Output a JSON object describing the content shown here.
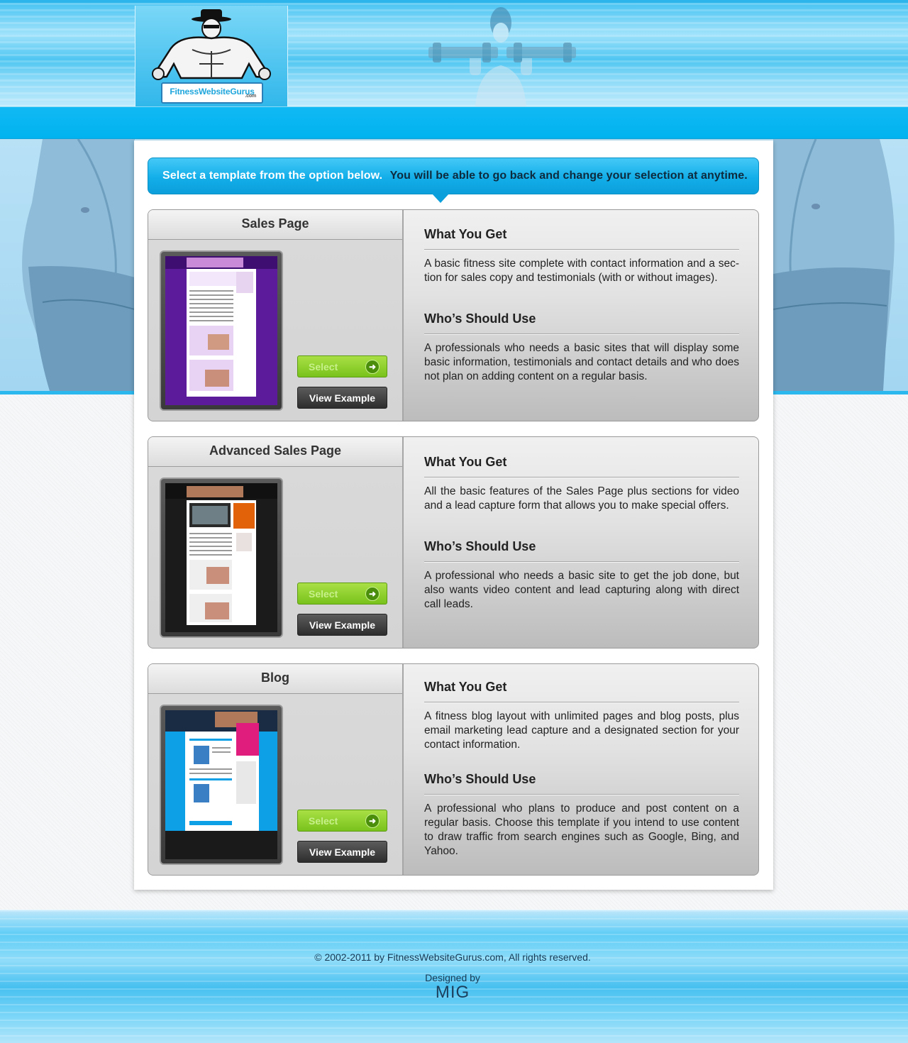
{
  "logo": {
    "name": "FitnessWebsiteGurus",
    "suffix": ".com"
  },
  "banner": {
    "text_white": "Select  a template from the option below.",
    "text_dark": "You will be able to go back and change your selection at anytime."
  },
  "templates": [
    {
      "title": "Sales Page",
      "select_label": "Select",
      "view_label": "View Example",
      "what_heading": "What You Get",
      "what_text": "A basic fitness site complete with contact information and a sec-tion for sales copy and testimonials (with or without images).",
      "who_heading": "Who’s Should Use",
      "who_text": "A professionals who needs a basic sites that will display some basic information, testimonials and contact details and who does not plan on adding content on a regular basis."
    },
    {
      "title": "Advanced Sales Page",
      "select_label": "Select",
      "view_label": "View Example",
      "what_heading": "What You Get",
      "what_text": "All the basic features of the Sales Page plus sections for video and a lead capture form that allows you to make special offers.",
      "who_heading": "Who’s Should Use",
      "who_text": "A professional who needs a basic site to get the job done, but also wants video content and lead capturing along with direct call leads."
    },
    {
      "title": "Blog",
      "select_label": "Select",
      "view_label": "View Example",
      "what_heading": "What You Get",
      "what_text": "A fitness blog layout with unlimited pages and blog posts, plus email marketing lead capture and a designated section for your contact information.",
      "who_heading": "Who’s Should Use",
      "who_text": "A professional who plans to produce and post content on a regular basis. Choose this template if you intend to use content to draw traffic from search engines such as Google, Bing, and Yahoo."
    }
  ],
  "footer": {
    "copyright": "© 2002-2011 by FitnessWebsiteGurus.com, All rights reserved.",
    "designed_by": "Designed by",
    "designer": "MIG"
  },
  "colors": {
    "header_blue": "#00b3ef",
    "select_green": "#79c21c",
    "view_dark": "#2d2d2d"
  }
}
